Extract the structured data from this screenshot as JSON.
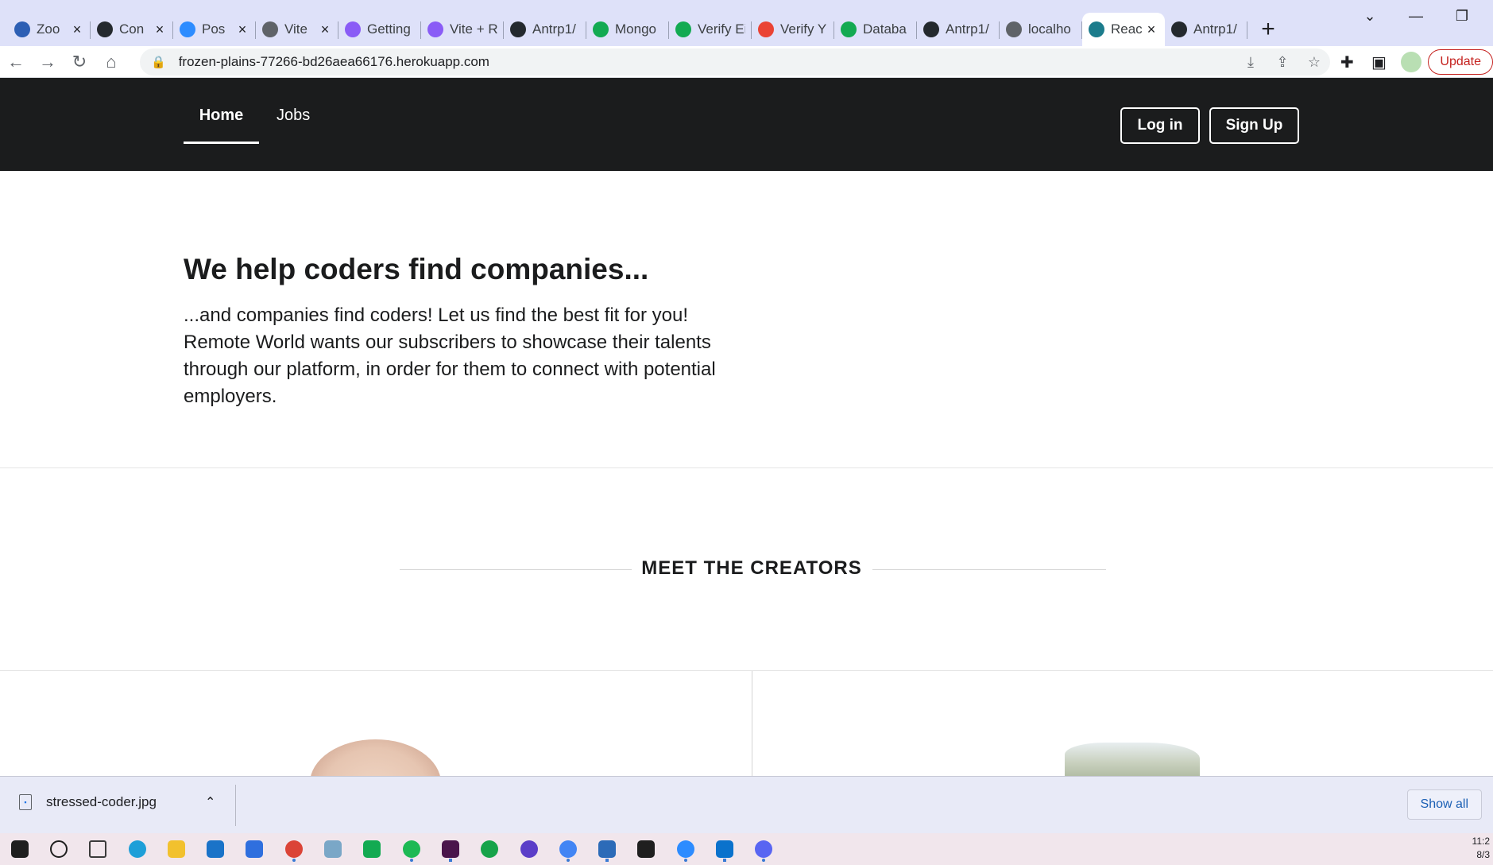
{
  "browser": {
    "tabs": [
      {
        "title": "Zoo",
        "icon": "zoom-icon",
        "color": "#2d5fb4",
        "closable": true,
        "active": false
      },
      {
        "title": "Con",
        "icon": "github-icon",
        "color": "#24292e",
        "closable": true,
        "active": false
      },
      {
        "title": "Pos",
        "icon": "zoom-icon",
        "color": "#2d8cff",
        "closable": true,
        "active": false
      },
      {
        "title": "Vite",
        "icon": "globe-icon",
        "color": "#5f6368",
        "closable": true,
        "active": false
      },
      {
        "title": "Getting",
        "icon": "vite-icon",
        "color": "#8a5cf6",
        "closable": false,
        "active": false
      },
      {
        "title": "Vite + R",
        "icon": "vite-icon",
        "color": "#8a5cf6",
        "closable": false,
        "active": false
      },
      {
        "title": "Antrp1/",
        "icon": "github-icon",
        "color": "#24292e",
        "closable": false,
        "active": false
      },
      {
        "title": "Mongo",
        "icon": "mongodb-icon",
        "color": "#13aa52",
        "closable": false,
        "active": false
      },
      {
        "title": "Verify Ei",
        "icon": "mongodb-icon",
        "color": "#13aa52",
        "closable": false,
        "active": false
      },
      {
        "title": "Verify Y",
        "icon": "gmail-icon",
        "color": "#ea4335",
        "closable": false,
        "active": false
      },
      {
        "title": "Databa",
        "icon": "mongodb-icon",
        "color": "#13aa52",
        "closable": false,
        "active": false
      },
      {
        "title": "Antrp1/",
        "icon": "github-icon",
        "color": "#24292e",
        "closable": false,
        "active": false
      },
      {
        "title": "localho",
        "icon": "globe-icon",
        "color": "#5f6368",
        "closable": false,
        "active": false
      },
      {
        "title": "Reac",
        "icon": "react-icon",
        "color": "#1c7c8c",
        "closable": true,
        "active": true
      },
      {
        "title": "Antrp1/",
        "icon": "github-icon",
        "color": "#24292e",
        "closable": false,
        "active": false
      }
    ],
    "new_tab": "+",
    "url": "frozen-plains-77266-bd26aea66176.herokuapp.com",
    "update_label": "Update"
  },
  "site": {
    "nav": {
      "home": "Home",
      "jobs": "Jobs",
      "login": "Log in",
      "signup": "Sign Up"
    },
    "hero": {
      "title": "We help coders find companies...",
      "text": "...and companies find coders! Let us find the best fit for you! Remote World wants our subscribers to showcase their talents through our platform, in order for them to connect with potential employers."
    },
    "creators_heading": "MEET THE CREATORS"
  },
  "downloads": {
    "file_name": "stressed-coder.jpg",
    "show_all": "Show all"
  },
  "taskbar": {
    "apps": [
      {
        "icon": "windows-start-icon",
        "color": "#1f1f1f",
        "open": false
      },
      {
        "icon": "search-icon",
        "color": "#1f1f1f",
        "open": false
      },
      {
        "icon": "task-view-icon",
        "color": "#3b3b3b",
        "open": false
      },
      {
        "icon": "edge-icon",
        "color": "#1e9fd8",
        "open": false
      },
      {
        "icon": "file-explorer-icon",
        "color": "#f2c12e",
        "open": false
      },
      {
        "icon": "mail-icon",
        "color": "#1a73c8",
        "open": false
      },
      {
        "icon": "todo-icon",
        "color": "#2f6fde",
        "open": false
      },
      {
        "icon": "chrome-profile-icon",
        "color": "#db4437",
        "open": true
      },
      {
        "icon": "notes-icon",
        "color": "#7aa7c7",
        "open": false
      },
      {
        "icon": "mongodb-compass-icon",
        "color": "#13aa52",
        "open": false
      },
      {
        "icon": "spotify-icon",
        "color": "#1db954",
        "open": true
      },
      {
        "icon": "slack-icon",
        "color": "#4a154b",
        "open": true
      },
      {
        "icon": "app-green-icon",
        "color": "#17a34a",
        "open": false
      },
      {
        "icon": "app-purple-icon",
        "color": "#5b3ec8",
        "open": false
      },
      {
        "icon": "chrome-icon",
        "color": "#4285f4",
        "open": true
      },
      {
        "icon": "photos-icon",
        "color": "#2c6bb8",
        "open": true
      },
      {
        "icon": "terminal-icon",
        "color": "#1f1f1f",
        "open": false
      },
      {
        "icon": "zoom-icon",
        "color": "#2d8cff",
        "open": true
      },
      {
        "icon": "vscode-icon",
        "color": "#0a72cc",
        "open": true
      },
      {
        "icon": "discord-icon",
        "color": "#5865f2",
        "open": true
      }
    ],
    "clock_time": "11:2",
    "clock_date": "8/3"
  }
}
